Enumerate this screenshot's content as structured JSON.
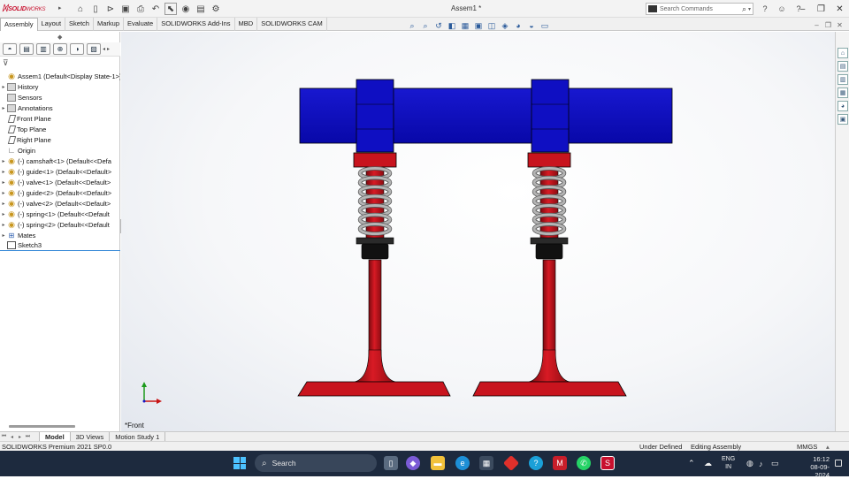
{
  "app": {
    "logo_brand": "SOLID",
    "logo_rest": "WORKS",
    "document_title": "Assem1 *",
    "search_placeholder": "Search Commands"
  },
  "command_tabs": [
    "Assembly",
    "Layout",
    "Sketch",
    "Markup",
    "Evaluate",
    "SOLIDWORKS Add-Ins",
    "MBD",
    "SOLIDWORKS CAM"
  ],
  "active_tab": "Assembly",
  "feature_tree": {
    "items": [
      {
        "label": "Assem1  (Default<Display State-1>)",
        "icon": "assembly-icon",
        "expander": ""
      },
      {
        "label": "History",
        "icon": "history-folder-icon",
        "expander": "▸"
      },
      {
        "label": "Sensors",
        "icon": "sensors-folder-icon",
        "expander": ""
      },
      {
        "label": "Annotations",
        "icon": "annotations-folder-icon",
        "expander": "▸"
      },
      {
        "label": "Front Plane",
        "icon": "plane-icon",
        "expander": ""
      },
      {
        "label": "Top Plane",
        "icon": "plane-icon",
        "expander": ""
      },
      {
        "label": "Right Plane",
        "icon": "plane-icon",
        "expander": ""
      },
      {
        "label": "Origin",
        "icon": "origin-icon",
        "expander": ""
      },
      {
        "label": "(-) camshaft<1> (Default<<Defa",
        "icon": "part-icon",
        "expander": "▸"
      },
      {
        "label": "(-) guide<1> (Default<<Default>",
        "icon": "part-icon",
        "expander": "▸"
      },
      {
        "label": "(-) valve<1> (Default<<Default>",
        "icon": "part-icon",
        "expander": "▸"
      },
      {
        "label": "(-) guide<2> (Default<<Default>",
        "icon": "part-icon",
        "expander": "▸"
      },
      {
        "label": "(-) valve<2> (Default<<Default>",
        "icon": "part-icon",
        "expander": "▸"
      },
      {
        "label": "(-) spring<1> (Default<<Default",
        "icon": "part-icon",
        "expander": "▸"
      },
      {
        "label": "(-) spring<2> (Default<<Default",
        "icon": "part-icon",
        "expander": "▸"
      },
      {
        "label": "Mates",
        "icon": "mates-icon",
        "expander": "▸"
      },
      {
        "label": "Sketch3",
        "icon": "sketch-icon",
        "expander": ""
      }
    ]
  },
  "viewport": {
    "view_name": "*Front",
    "colors": {
      "camshaft": "#1010c8",
      "valve": "#c8141e",
      "spring": "#b4b4b4",
      "guide": "#1a1a1a"
    }
  },
  "bottom_tabs": [
    "Model",
    "3D Views",
    "Motion Study 1"
  ],
  "active_bottom_tab": "Model",
  "status_bar": {
    "product": "SOLIDWORKS Premium 2021 SP0.0",
    "state": "Under Defined",
    "mode": "Editing Assembly",
    "units": "MMGS"
  },
  "taskbar": {
    "search_label": "Search",
    "lang_line1": "ENG",
    "lang_line2": "IN",
    "time": "16:12",
    "date": "08-09-2024"
  }
}
